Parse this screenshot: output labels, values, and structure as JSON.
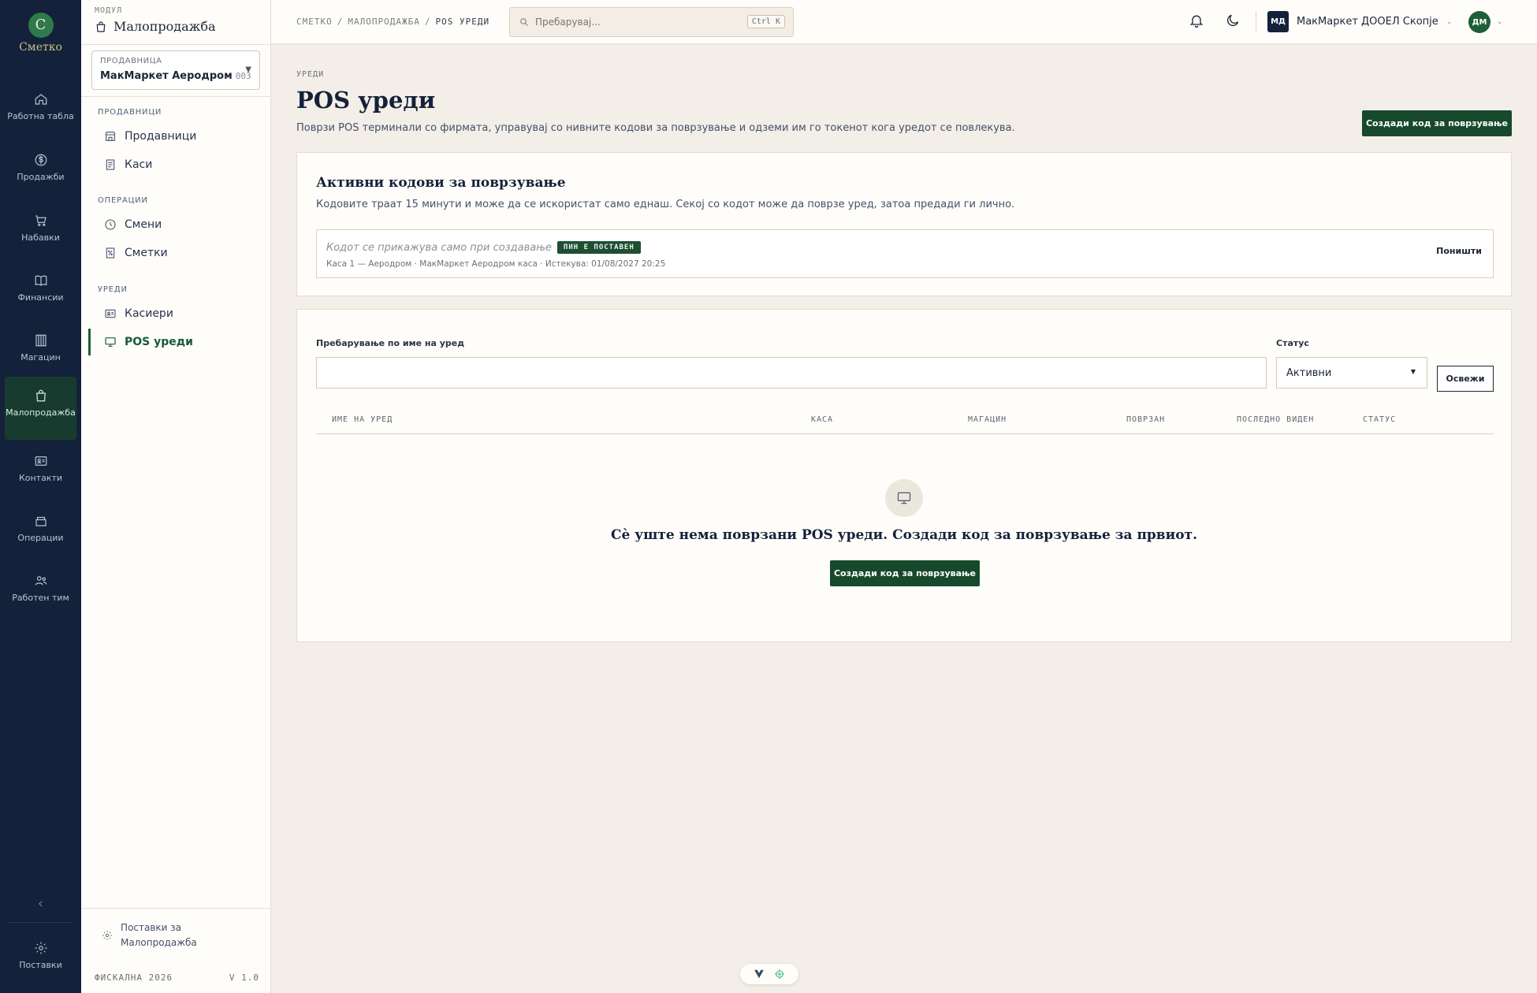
{
  "brand": {
    "initial": "С",
    "name": "Сметко"
  },
  "rail": {
    "items": [
      {
        "label": "Работна табла",
        "icon": "home-icon"
      },
      {
        "label": "Продажби",
        "icon": "dollar-icon"
      },
      {
        "label": "Набавки",
        "icon": "cart-icon"
      },
      {
        "label": "Финансии",
        "icon": "book-icon"
      },
      {
        "label": "Магацин",
        "icon": "warehouse-icon"
      },
      {
        "label": "Малопродажба",
        "icon": "bag-icon",
        "active": true
      },
      {
        "label": "Контакти",
        "icon": "contact-card-icon"
      },
      {
        "label": "Операции",
        "icon": "box-icon"
      },
      {
        "label": "Работен тим",
        "icon": "team-icon"
      }
    ],
    "collapse": "‹",
    "settings": "Поставки"
  },
  "module": {
    "caption": "МОДУЛ",
    "title": "Малопродажба",
    "store_caption": "ПРОДАВНИЦА",
    "store_name": "МакМаркет Аеродром",
    "store_code": "003",
    "groups": [
      {
        "label": "ПРОДАВНИЦИ",
        "items": [
          "Продавници",
          "Каси"
        ]
      },
      {
        "label": "ОПЕРАЦИИ",
        "items": [
          "Смени",
          "Сметки"
        ]
      },
      {
        "label": "УРЕДИ",
        "items": [
          "Касиери",
          "POS уреди"
        ]
      }
    ],
    "settings_link": "Поставки за Малопродажба",
    "footer_left": "ФИСКАЛНА 2026",
    "footer_right": "V 1.0"
  },
  "topbar": {
    "breadcrumb": [
      "СМЕТКО",
      "МАЛОПРОДАЖБА",
      "POS УРЕДИ"
    ],
    "search_placeholder": "Пребарувај...",
    "search_shortcut": "Ctrl K",
    "org_initials": "МД",
    "org_name": "МакМаркет ДООЕЛ Скопје",
    "user_initials": "ДМ"
  },
  "page": {
    "eyebrow": "УРЕДИ",
    "title": "POS уреди",
    "subtitle": "Поврзи POS терминали со фирмата, управувај со нивните кодови за поврзување и одземи им го токенот кога уредот се повлекува.",
    "create_button": "Создади код за поврзување"
  },
  "active_codes": {
    "title": "Активни кодови за поврзување",
    "description": "Кодовите траат 15 минути и може да се искористат само еднаш. Секој со кодот може да поврзе уред, затоа предади ги лично.",
    "code_placeholder": "Кодот се прикажува само при создавање",
    "pin_badge": "ПИН Е ПОСТАВЕН",
    "meta": "Каса 1 — Аеродром · МакМаркет Аеродром каса · Истекува: 01/08/2027 20:25",
    "cancel_button": "Поништи"
  },
  "devices": {
    "search_label": "Пребарување по име на уред",
    "search_value": "",
    "status_label": "Статус",
    "status_value": "Активни",
    "refresh_button": "Освежи",
    "columns": [
      "ИМЕ НА УРЕД",
      "КАСА",
      "МАГАЦИН",
      "ПОВРЗАН",
      "ПОСЛЕДНО ВИДЕН",
      "СТАТУС"
    ],
    "rows": [],
    "empty_text": "Сè уште нема поврзани POS уреди. Создади код за поврзување за првиот.",
    "empty_button": "Создади код за поврзување"
  },
  "colors": {
    "rail_bg": "#14213a",
    "accent": "#17492c",
    "page_bg": "#f3eee7"
  }
}
